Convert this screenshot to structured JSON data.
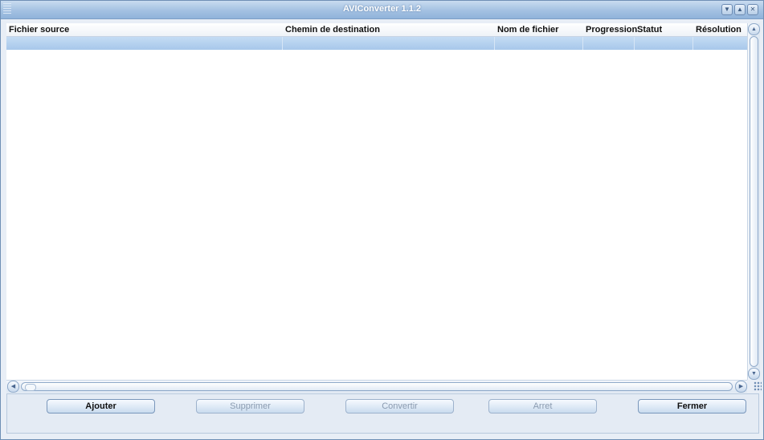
{
  "window": {
    "title": "AVIConverter 1.1.2",
    "controls": [
      "minimize",
      "maximize",
      "close"
    ]
  },
  "table": {
    "columns": [
      {
        "key": "source",
        "label": "Fichier source"
      },
      {
        "key": "dest",
        "label": "Chemin de destination"
      },
      {
        "key": "filename",
        "label": "Nom de fichier"
      },
      {
        "key": "progress",
        "label": "Progression"
      },
      {
        "key": "status",
        "label": "Statut"
      },
      {
        "key": "resolution",
        "label": "Résolution"
      }
    ],
    "rows": [
      {
        "source": "",
        "dest": "",
        "filename": "",
        "progress": "",
        "status": "",
        "resolution": "",
        "selected": true
      }
    ]
  },
  "buttons": {
    "add": {
      "label": "Ajouter",
      "enabled": true
    },
    "remove": {
      "label": "Supprimer",
      "enabled": false
    },
    "convert": {
      "label": "Convertir",
      "enabled": false
    },
    "stop": {
      "label": "Arret",
      "enabled": false
    },
    "close": {
      "label": "Fermer",
      "enabled": true
    }
  }
}
